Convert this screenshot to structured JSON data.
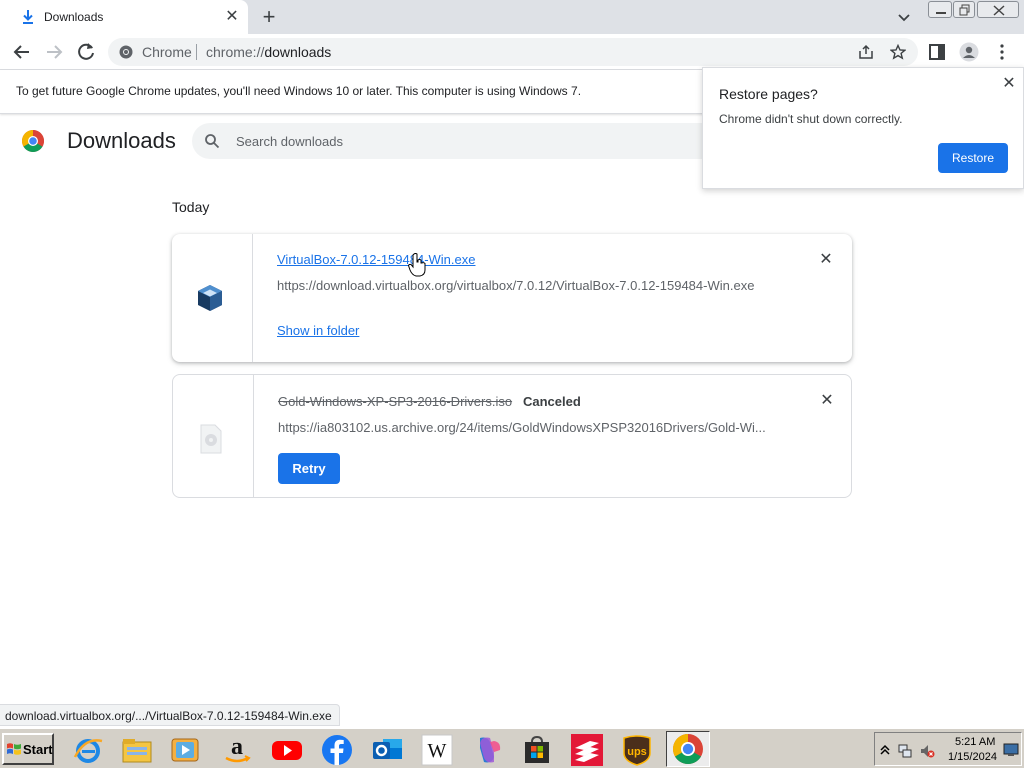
{
  "tab": {
    "title": "Downloads",
    "icon": "download-icon"
  },
  "omnibox": {
    "site_name": "Chrome",
    "url_scheme": "chrome://",
    "url_path": "downloads"
  },
  "infobar": {
    "message": "To get future Google Chrome updates, you'll need Windows 10 or later. This computer is using Windows 7."
  },
  "header": {
    "title": "Downloads",
    "search_placeholder": "Search downloads"
  },
  "restore_popup": {
    "title": "Restore pages?",
    "message": "Chrome didn't shut down correctly.",
    "button": "Restore"
  },
  "section": {
    "label": "Today"
  },
  "downloads": [
    {
      "filename": "VirtualBox-7.0.12-159484-Win.exe",
      "url": "https://download.virtualbox.org/virtualbox/7.0.12/VirtualBox-7.0.12-159484-Win.exe",
      "action": "Show in folder",
      "status": ""
    },
    {
      "filename": "Gold-Windows-XP-SP3-2016-Drivers.iso",
      "url": "https://ia803102.us.archive.org/24/items/GoldWindowsXPSP32016Drivers/Gold-Wi...",
      "action": "Retry",
      "status": "Canceled"
    }
  ],
  "status_bubble": "download.virtualbox.org/.../VirtualBox-7.0.12-159484-Win.exe",
  "taskbar": {
    "start_label": "Start",
    "apps": [
      "internet-explorer",
      "file-explorer",
      "media-player",
      "amazon",
      "youtube",
      "facebook",
      "outlook",
      "wikipedia",
      "copilot",
      "store",
      "bank-of-america",
      "ups",
      "chrome"
    ],
    "clock_time": "5:21 AM",
    "clock_date": "1/15/2024"
  },
  "colors": {
    "accent": "#1a73e8",
    "taskbar": "#d4d0c8"
  }
}
